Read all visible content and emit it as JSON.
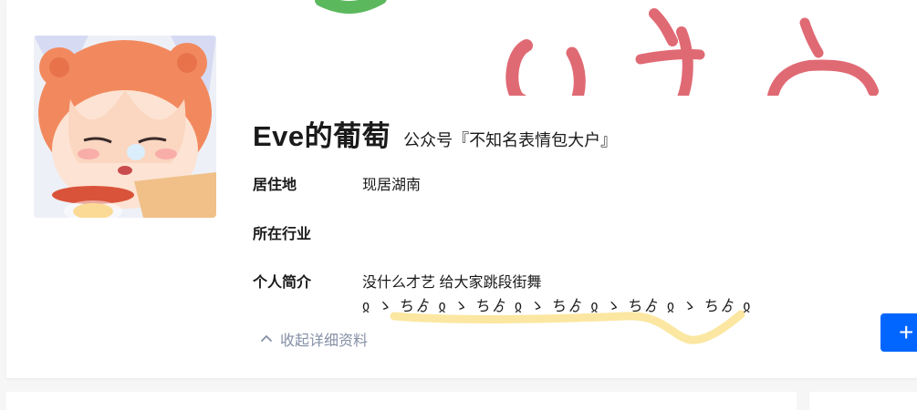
{
  "profile": {
    "name": "Eve的葡萄",
    "headline": "公众号『不知名表情包大户』",
    "details": [
      {
        "label": "居住地",
        "value": "现居湖南"
      },
      {
        "label": "所在行业",
        "value": ""
      },
      {
        "label": "个人简介",
        "value": "没什么才艺 给大家跳段街舞"
      }
    ],
    "bio_line2": "ჲ ゝ ちゟ ჲ ゝ ちゟ ჲ ゝ ちゟ ჲ ゝ ちゟ ჲ ゝ ちゟ ჲ",
    "collapse_label": "收起详细资料",
    "follow_symbol": "+"
  },
  "icons": {
    "avatar": "anime-avatar-image",
    "cover": "cover-image",
    "collapse": "chevron-up-icon",
    "follow": "plus-icon"
  },
  "colors": {
    "accent": "#0066ff",
    "muted": "#8590a6",
    "highlight": "#fbe7a1"
  }
}
